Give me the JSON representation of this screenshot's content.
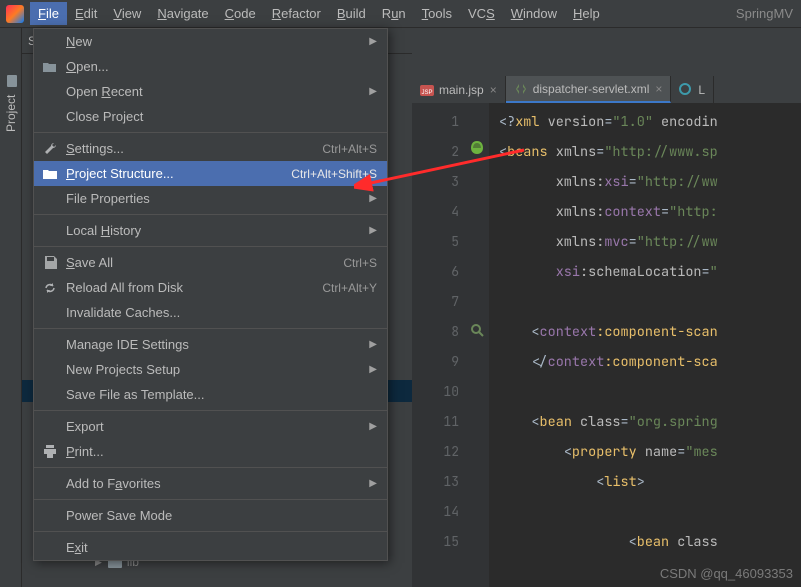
{
  "menubar": {
    "items": [
      {
        "label": "File",
        "hotkey": "F"
      },
      {
        "label": "Edit",
        "hotkey": "E"
      },
      {
        "label": "View",
        "hotkey": "V"
      },
      {
        "label": "Navigate",
        "hotkey": "N"
      },
      {
        "label": "Code",
        "hotkey": "C"
      },
      {
        "label": "Refactor",
        "hotkey": "R"
      },
      {
        "label": "Build",
        "hotkey": "B"
      },
      {
        "label": "Run",
        "hotkey": "u"
      },
      {
        "label": "Tools",
        "hotkey": "T"
      },
      {
        "label": "VCS",
        "hotkey": "S"
      },
      {
        "label": "Window",
        "hotkey": "W"
      },
      {
        "label": "Help",
        "hotkey": "H"
      }
    ],
    "active_index": 0,
    "right_title": "SpringMV"
  },
  "left_tool": {
    "label": "Project"
  },
  "breadcrumb_preview": "Sp",
  "dropdown": {
    "groups": [
      [
        {
          "label": "New",
          "hotkey": "N",
          "submenu": true
        },
        {
          "label": "Open...",
          "hotkey": "O",
          "icon": "folder-open"
        },
        {
          "label": "Open Recent",
          "hotkey": "R",
          "submenu": true
        },
        {
          "label": "Close Project"
        }
      ],
      [
        {
          "label": "Settings...",
          "hotkey": "S",
          "shortcut": "Ctrl+Alt+S",
          "icon": "wrench"
        },
        {
          "label": "Project Structure...",
          "hotkey": "P",
          "shortcut": "Ctrl+Alt+Shift+S",
          "icon": "folder",
          "highlighted": true
        },
        {
          "label": "File Properties",
          "submenu": true
        }
      ],
      [
        {
          "label": "Local History",
          "hotkey": "H",
          "submenu": true
        }
      ],
      [
        {
          "label": "Save All",
          "hotkey": "S",
          "shortcut": "Ctrl+S",
          "icon": "disk"
        },
        {
          "label": "Reload All from Disk",
          "shortcut": "Ctrl+Alt+Y",
          "icon": "reload"
        },
        {
          "label": "Invalidate Caches..."
        }
      ],
      [
        {
          "label": "Manage IDE Settings",
          "submenu": true
        },
        {
          "label": "New Projects Setup",
          "submenu": true
        },
        {
          "label": "Save File as Template..."
        }
      ],
      [
        {
          "label": "Export",
          "submenu": true
        },
        {
          "label": "Print...",
          "hotkey": "P",
          "icon": "print"
        }
      ],
      [
        {
          "label": "Add to Favorites",
          "hotkey": "a",
          "submenu": true
        }
      ],
      [
        {
          "label": "Power Save Mode"
        }
      ],
      [
        {
          "label": "Exit",
          "hotkey": "x"
        }
      ]
    ]
  },
  "editor_tabs": [
    {
      "label": "main.jsp",
      "icon": "jsp",
      "active": false,
      "closable": true
    },
    {
      "label": "dispatcher-servlet.xml",
      "icon": "xml",
      "active": true,
      "closable": true
    },
    {
      "label": "L",
      "icon": "circle",
      "active": false,
      "closable": false
    }
  ],
  "code": {
    "line_numbers": [
      1,
      2,
      3,
      4,
      5,
      6,
      7,
      8,
      9,
      10,
      11,
      12,
      13,
      14,
      15
    ],
    "lines_html": [
      "<span class='c-text'>&lt;?</span><span class='c-tag'>xml </span><span class='c-attr'>version</span><span class='c-text'>=</span><span class='c-str'>\"1.0\"</span><span class='c-attr'> encodin</span>",
      "<span class='c-text'>&lt;</span><span class='c-tag'>beans </span><span class='c-attr'>xmlns</span><span class='c-text'>=</span><span class='c-str'>\"http://www.sp</span>",
      "       <span class='c-attr'>xmlns:</span><span class='c-ns'>xsi</span><span class='c-text'>=</span><span class='c-str'>\"http://ww</span>",
      "       <span class='c-attr'>xmlns:</span><span class='c-ns'>context</span><span class='c-text'>=</span><span class='c-str'>\"http:</span>",
      "       <span class='c-attr'>xmlns:</span><span class='c-ns'>mvc</span><span class='c-text'>=</span><span class='c-str'>\"http://ww</span>",
      "       <span class='c-ns'>xsi</span><span class='c-attr'>:schemaLocation</span><span class='c-text'>=</span><span class='c-str'>\"</span>",
      "",
      "    <span class='c-text'>&lt;</span><span class='c-ns'>context</span><span class='c-tag'>:component-scan</span>",
      "    <span class='c-text'>&lt;/</span><span class='c-ns'>context</span><span class='c-tag'>:component-sca</span>",
      "",
      "    <span class='c-text'>&lt;</span><span class='c-tag'>bean </span><span class='c-attr'>class</span><span class='c-text'>=</span><span class='c-str'>\"org.spring</span>",
      "        <span class='c-text'>&lt;</span><span class='c-tag'>property </span><span class='c-attr'>name</span><span class='c-text'>=</span><span class='c-str'>\"mes</span>",
      "            <span class='c-text'>&lt;</span><span class='c-tag'>list</span><span class='c-text'>&gt;</span>",
      "",
      "                <span class='c-text'>&lt;</span><span class='c-tag'>bean </span><span class='c-attr'>class</span>"
    ]
  },
  "tree_below": {
    "label": "lib"
  },
  "watermark": "CSDN @qq_46093353"
}
